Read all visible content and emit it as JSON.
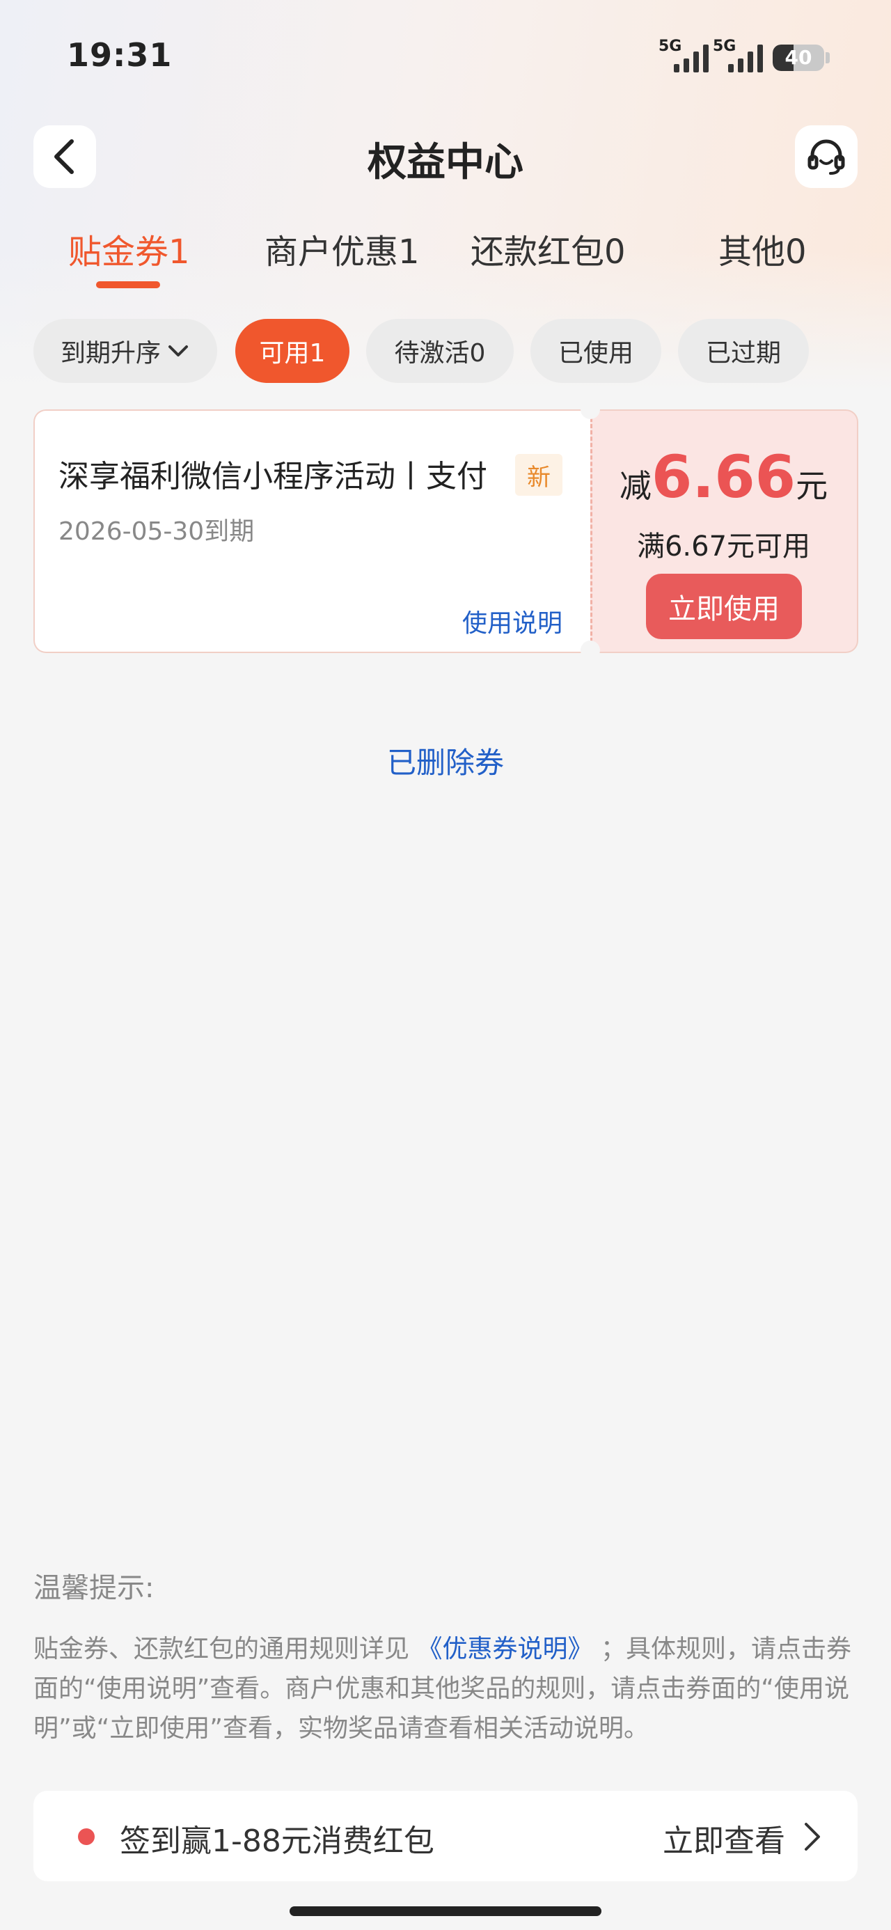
{
  "status_bar": {
    "time": "19:31",
    "network_1": "5G",
    "network_2": "5G",
    "battery": "40",
    "battery_level": 0.4
  },
  "header": {
    "title": "权益中心",
    "back_icon": "chevron-left-icon",
    "service_icon": "headset-icon"
  },
  "tabs": [
    {
      "label": "贴金券1",
      "active": true
    },
    {
      "label": "商户优惠1",
      "active": false
    },
    {
      "label": "还款红包0",
      "active": false
    },
    {
      "label": "其他0",
      "active": false
    }
  ],
  "filters": {
    "sort_label": "到期升序",
    "chips": [
      {
        "label": "可用1",
        "active": true
      },
      {
        "label": "待激活0",
        "active": false
      },
      {
        "label": "已使用",
        "active": false
      },
      {
        "label": "已过期",
        "active": false
      }
    ]
  },
  "coupon": {
    "title": "深享福利微信小程序活动丨支付",
    "badge": "新",
    "expiry": "2026-05-30到期",
    "instructions_link": "使用说明",
    "amount_prefix": "减",
    "amount_value": "6.66",
    "amount_unit": "元",
    "condition": "满6.67元可用",
    "use_button": "立即使用"
  },
  "deleted_link": "已删除券",
  "tips": {
    "title": "温馨提示:",
    "body_part1": "贴金券、还款红包的通用规则详见",
    "body_link": "《优惠券说明》",
    "body_part2": "；具体规则，请点击券面的“使用说明”查看。商户优惠和其他奖品的规则，请点击券面的“使用说明”或“立即使用”查看，实物奖品请查看相关活动说明。"
  },
  "promo": {
    "text": "签到赢1-88元消费红包",
    "action": "立即查看"
  },
  "colors": {
    "accent": "#f0572d",
    "coupon_red": "#eb5454",
    "link_blue": "#2260c8"
  }
}
